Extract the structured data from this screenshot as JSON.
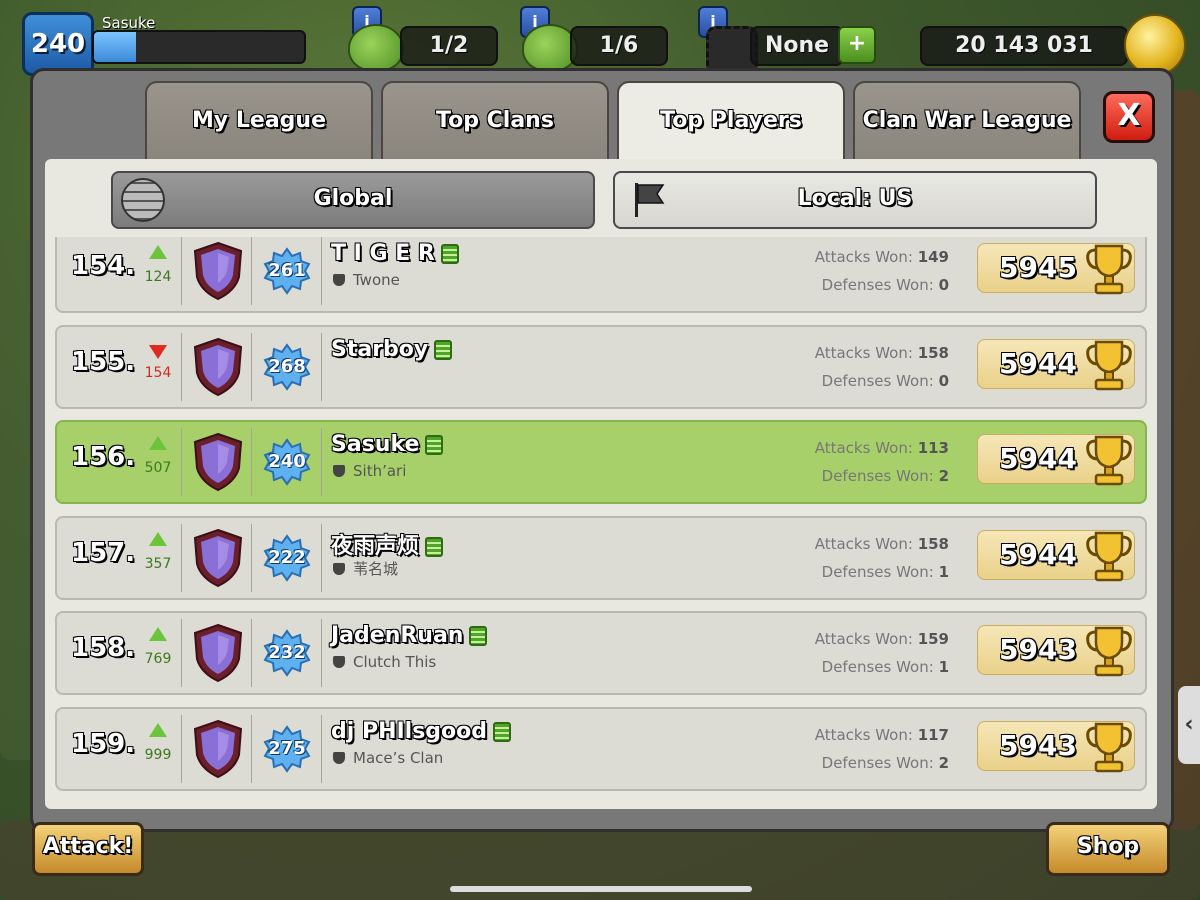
{
  "hud": {
    "level": "240",
    "player_name": "Sasuke",
    "xp_progress": 0.2,
    "builder_slot_1": "1/2",
    "builder_slot_2": "1/6",
    "builder_slot_3": "None",
    "info_label": "i",
    "plus_label": "+",
    "gold": "20 143 031"
  },
  "tabs": [
    {
      "label": "My League",
      "active": false
    },
    {
      "label": "Top Clans",
      "active": false
    },
    {
      "label": "Top Players",
      "active": true
    },
    {
      "label": "Clan War League",
      "active": false
    }
  ],
  "close_label": "X",
  "scope": {
    "global_label": "Global",
    "local_label": "Local: US",
    "selected": "local"
  },
  "labels": {
    "attacks_won": "Attacks Won:",
    "defenses_won": "Defenses Won:"
  },
  "rows": [
    {
      "rank": "154.",
      "trend": "up",
      "delta": "124",
      "level": "261",
      "name": "T I G E R",
      "clan": "Twone",
      "attacks": "149",
      "defenses": "0",
      "trophies": "5945",
      "highlighted": false
    },
    {
      "rank": "155.",
      "trend": "down",
      "delta": "154",
      "level": "268",
      "name": "Starboy",
      "clan": "",
      "attacks": "158",
      "defenses": "0",
      "trophies": "5944",
      "highlighted": false
    },
    {
      "rank": "156.",
      "trend": "up",
      "delta": "507",
      "level": "240",
      "name": "Sasuke",
      "clan": "Sith’ari",
      "attacks": "113",
      "defenses": "2",
      "trophies": "5944",
      "highlighted": true
    },
    {
      "rank": "157.",
      "trend": "up",
      "delta": "357",
      "level": "222",
      "name": "夜雨声烦",
      "clan": "苇名城",
      "attacks": "158",
      "defenses": "1",
      "trophies": "5944",
      "highlighted": false
    },
    {
      "rank": "158.",
      "trend": "up",
      "delta": "769",
      "level": "232",
      "name": "JadenRuan",
      "clan": "Clutch This",
      "attacks": "159",
      "defenses": "1",
      "trophies": "5943",
      "highlighted": false
    },
    {
      "rank": "159.",
      "trend": "up",
      "delta": "999",
      "level": "275",
      "name": "dj PHIlsgood",
      "clan": "Mace’s Clan",
      "attacks": "117",
      "defenses": "2",
      "trophies": "5943",
      "highlighted": false
    }
  ],
  "bottom": {
    "attack_label": "Attack!",
    "shop_label": "Shop"
  },
  "side_tab_glyph": "‹",
  "colors": {
    "highlight_row": "#a7d06a",
    "trend_up": "#6cc43a",
    "trend_down": "#e0291f",
    "league": "#8a6fd6"
  }
}
